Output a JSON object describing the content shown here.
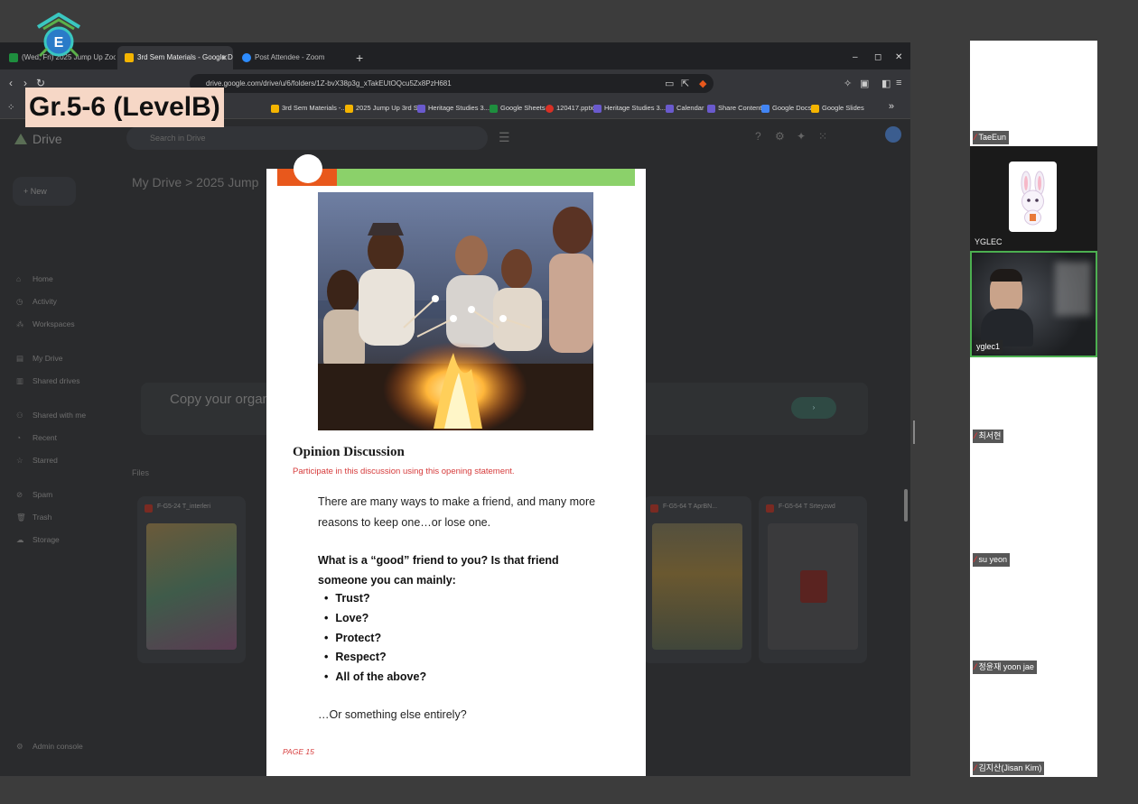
{
  "browser": {
    "tabs": [
      {
        "label": "(Wed, Fri) 2025 Jump Up Zoom A",
        "color": "#1e8e3e"
      },
      {
        "label": "3rd Sem Materials - Google Drive",
        "color": "#f4b400"
      },
      {
        "label": "Post Attendee - Zoom",
        "color": "#2d8cff"
      }
    ],
    "url": "drive.google.com/drive/u/6/folders/1Z-bvX38p3g_xTakEUtOQcu5Zx8PzH681",
    "bookmarks": [
      {
        "label": "3rd Sem Materials -...",
        "color": "#f4b400"
      },
      {
        "label": "2025 Jump Up 3rd S...",
        "color": "#f4b400"
      },
      {
        "label": "Heritage Studies 3...",
        "color": "#6a5acd"
      },
      {
        "label": "Google Sheets",
        "color": "#1e8e3e"
      },
      {
        "label": "120417.pptx",
        "color": "#d93025"
      },
      {
        "label": "Heritage Studies 3...",
        "color": "#6a5acd"
      },
      {
        "label": "Calendar",
        "color": "#6a5acd"
      },
      {
        "label": "Share Content",
        "color": "#6a5acd"
      },
      {
        "label": "Google Docs",
        "color": "#4285f4"
      },
      {
        "label": "Google Slides",
        "color": "#f4b400"
      }
    ]
  },
  "drive": {
    "logo": "Drive",
    "search_placeholder": "Search in Drive",
    "new_label": "New",
    "breadcrumb": "My Drive  >  2025 Jump",
    "sidebar": [
      "Home",
      "Activity",
      "Workspaces",
      "My Drive",
      "Shared drives",
      "Shared with me",
      "Recent",
      "Starred",
      "Spam",
      "Trash",
      "Storage"
    ],
    "banner_title": "Copy your organiz",
    "files_label": "Files",
    "card_left": "F-G5-24 T_interleri",
    "card_right1": "F-G5-64 T AprBN...",
    "card_right2": "F-G5-64 T Srteyzwd",
    "admin_console": "Admin console"
  },
  "document": {
    "title": "Opinion Discussion",
    "subtitle": "Participate in this discussion using this opening statement.",
    "paragraph": "There are many ways to make a friend, and many more reasons to keep one…or lose one.",
    "question": "What is a “good” friend to you? Is that friend someone you can mainly:",
    "options": [
      "Trust?",
      "Love?",
      "Protect?",
      "Respect?",
      "All of the above?"
    ],
    "closing": "…Or something else entirely?",
    "page": "PAGE 15"
  },
  "overlay": {
    "level": "Gr.5-6 (LevelB)"
  },
  "participants": [
    {
      "name": "TaeEun",
      "muted": true
    },
    {
      "name": "YGLEC",
      "muted": false
    },
    {
      "name": "yglec1",
      "muted": false
    },
    {
      "name": "최서현",
      "muted": true
    },
    {
      "name": "su yeon",
      "muted": true
    },
    {
      "name": "정윤재 yoon jae",
      "muted": true
    },
    {
      "name": "김지산(Jisan Kim)",
      "muted": true
    }
  ],
  "colors": {
    "accent_green": "#8bd16a",
    "accent_orange": "#e8581c",
    "badge_bg": "#f6d7c6",
    "active_speaker": "#4caf50"
  }
}
